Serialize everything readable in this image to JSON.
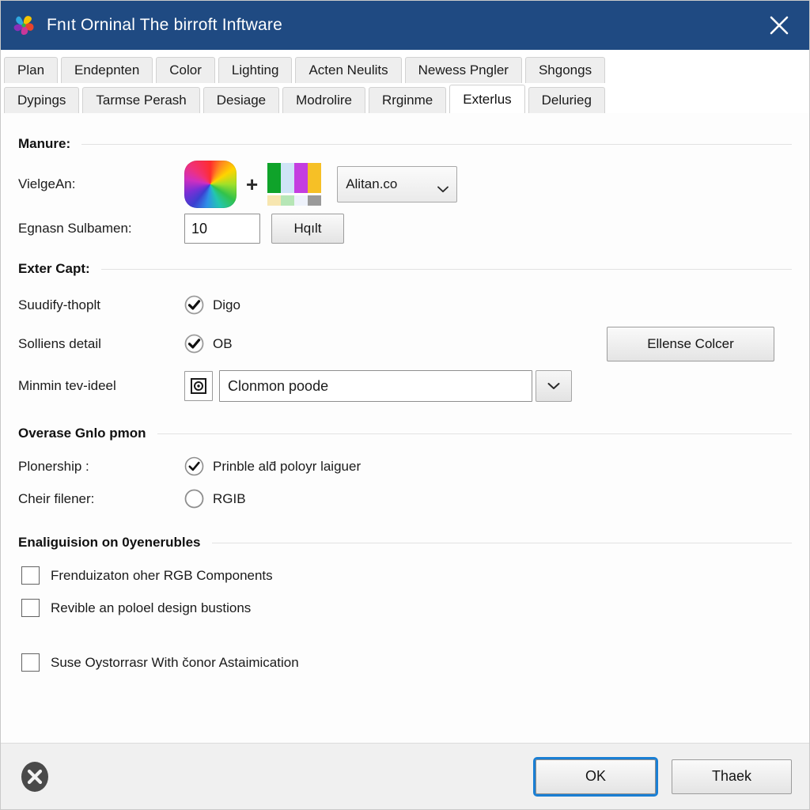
{
  "window": {
    "title": "Fnıt Orninal The birroft Inftware",
    "logo_icon": "pinwheel-logo-icon",
    "close_icon": "close-icon",
    "titlebar_color": "#1f4a82"
  },
  "tabs": {
    "row1": [
      {
        "label": "Plan",
        "active": false
      },
      {
        "label": "Endepnten",
        "active": false
      },
      {
        "label": "Color",
        "active": false
      },
      {
        "label": "Lighting",
        "active": false
      },
      {
        "label": "Acten Neulits",
        "active": false
      },
      {
        "label": "Newess Pngler",
        "active": false
      },
      {
        "label": "Shgongs",
        "active": false
      }
    ],
    "row2": [
      {
        "label": "Dypings",
        "active": false
      },
      {
        "label": "Tarmse Perash",
        "active": false
      },
      {
        "label": "Desiage",
        "active": false
      },
      {
        "label": "Modrolire",
        "active": false
      },
      {
        "label": "Rrginme",
        "active": false
      },
      {
        "label": "Exterlus",
        "active": true
      },
      {
        "label": "Delurieg",
        "active": false
      }
    ]
  },
  "sections": {
    "manure": {
      "heading": "Manure:",
      "vielgean_label": "VielgeAn:",
      "wheel_icon": "color-wheel-icon",
      "plus_symbol": "+",
      "palette_icon": "color-palette-icon",
      "palette_top_colors": [
        "#0fa32a",
        "#cfe4f7",
        "#c43ee0",
        "#f6c026"
      ],
      "palette_bottom_colors": [
        "#f7e6b0",
        "#b6e6b6",
        "#eef2fb",
        "#9a9a9a"
      ],
      "dropdown_value": "Alitan.co",
      "dropdown_caret_icon": "chevron-down-icon",
      "egnasn_label": "Egnasn Sulbamen:",
      "egnasn_value": "10",
      "hqilt_button": "Hqılt"
    },
    "exter_capt": {
      "heading": "Exter Capt:",
      "rows": [
        {
          "label": "Suudify-thoplt",
          "option": "Digo",
          "checked": true
        },
        {
          "label": "Solliens detail",
          "option": "OB",
          "checked": true
        }
      ],
      "ellense_button": "Ellense Colcer",
      "minmin_label": "Minmin tev-ideel",
      "minmin_icon": "target-icon",
      "minmin_value": "Clonmon poode",
      "minmin_caret_icon": "chevron-down-icon"
    },
    "overase": {
      "heading": "Overase Gnlo pmon",
      "rows": [
        {
          "label": "Plonership :",
          "option": "Prinble ald̄ poloyr laiguer",
          "checked": true
        },
        {
          "label": "Cheir filener:",
          "option": "RGIB",
          "checked": false
        }
      ]
    },
    "enaliguision": {
      "heading": "Enaliguision on 0yenerubles",
      "checkboxes": [
        {
          "label": "Frenduizaton oher RGB Components",
          "checked": false
        },
        {
          "label": "Revible an poloel design bustions",
          "checked": false
        }
      ],
      "extra_checkbox": {
        "label": "Suse Oystorrasr With čonor Astaimication",
        "checked": false
      }
    }
  },
  "footer": {
    "x_icon": "close-circle-icon",
    "ok_label": "OK",
    "cancel_label": "Thaek",
    "focus_color": "#1a7fd4"
  }
}
